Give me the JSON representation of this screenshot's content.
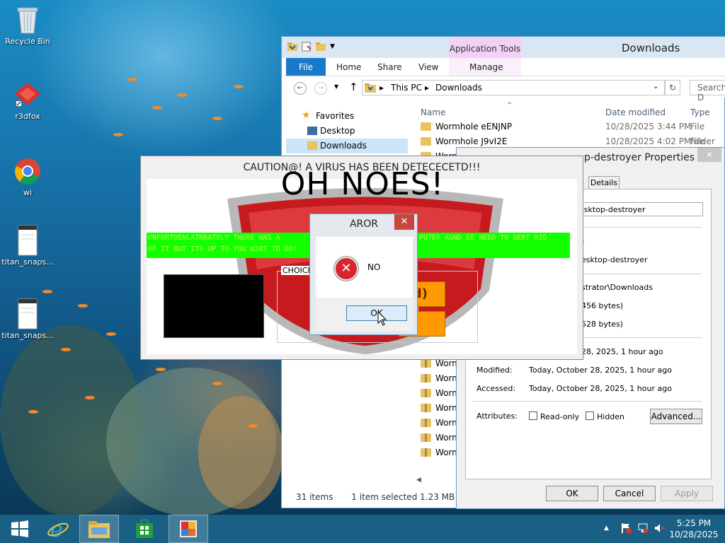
{
  "desktop": {
    "icons": [
      {
        "label": "Recycle Bin",
        "icon": "recycle-bin-icon"
      },
      {
        "label": "r3dfox",
        "icon": "r3dfox-icon"
      },
      {
        "label": "wi",
        "icon": "chrome-icon"
      },
      {
        "label": "titan_snaps...",
        "icon": "document-icon"
      },
      {
        "label": "titan_snaps...",
        "icon": "document-icon"
      }
    ]
  },
  "explorer": {
    "title": "Downloads",
    "app_tools": "Application Tools",
    "tabs": {
      "file": "File",
      "home": "Home",
      "share": "Share",
      "view": "View",
      "manage": "Manage"
    },
    "address": {
      "crumb1": "This PC",
      "crumb2": "Downloads"
    },
    "search_placeholder": "Search D",
    "nav": {
      "favorites": "Favorites",
      "desktop": "Desktop",
      "downloads": "Downloads"
    },
    "columns": {
      "name": "Name",
      "date": "Date modified",
      "type": "Type"
    },
    "files": [
      {
        "name": "Wormhole eENJNP",
        "date": "10/28/2025 3:44 PM",
        "type": "File folder"
      },
      {
        "name": "Wormhole J9vI2E",
        "date": "10/28/2025 4:02 PM",
        "type": "File folder"
      }
    ],
    "partial_files": [
      "Worm",
      "Worm",
      "Worm",
      "Worm",
      "Worm",
      "Worm",
      "Worm",
      "Worm"
    ],
    "status": {
      "items": "31 items",
      "selected": "1 item selected  1.23 MB"
    }
  },
  "properties": {
    "title": "p-destroyer Properties",
    "tab_details": "Details",
    "name_value": "esktop-destroyer",
    "paren": ")",
    "opens_with": "esktop-destroyer",
    "location": "strator\\Downloads",
    "size": "456 bytes)",
    "size_on_disk": "528 bytes)",
    "created": "28, 2025, 1 hour ago",
    "modified_label": "Modified:",
    "modified": "Today, October 28, 2025, 1 hour ago",
    "accessed_label": "Accessed:",
    "accessed": "Today, October 28, 2025, 1 hour ago",
    "attributes_label": "Attributes:",
    "readonly": "Read-only",
    "hidden": "Hidden",
    "advanced": "Advanced...",
    "ok": "OK",
    "cancel": "Cancel",
    "apply": "Apply"
  },
  "virus": {
    "title": "CAUTION@! A VIRUS HAS BEEN DETECECETD!!!",
    "headline": "OH NOES!",
    "banner_line1": "UNFORTOENLATRRATELY THERE WAS A",
    "banner_line1_end": "PUTER ASND EE NEED TO GERT RID",
    "banner_line2": "OF IT BUT ITS UP TO YOU WJAT TO DO!",
    "choice_label": "CHOICE",
    "button1_fragment": "nd)"
  },
  "dialog": {
    "title": "AROR",
    "message": "NO",
    "ok": "OK"
  },
  "taskbar": {
    "time": "5:25 PM",
    "date": "10/28/2025"
  }
}
